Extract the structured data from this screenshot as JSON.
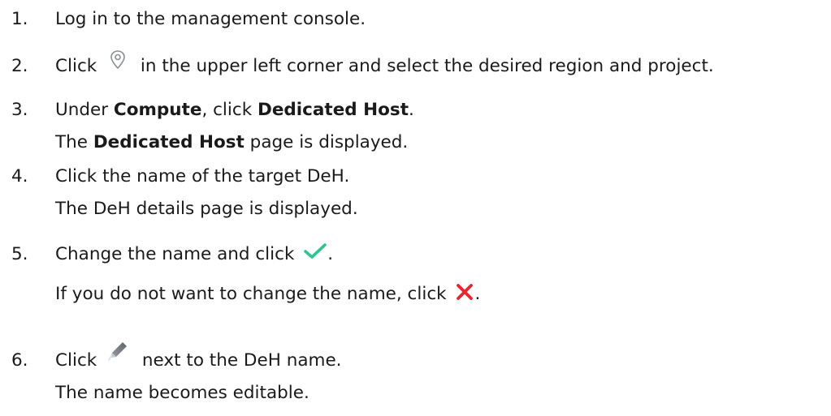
{
  "steps": [
    {
      "number": "1.",
      "text": "Log in to the management console."
    },
    {
      "number": "2.",
      "before": "Click",
      "icon": "location-pin-icon",
      "after": "in the upper left corner and select the desired region and project."
    },
    {
      "number": "3.",
      "t1": "Under ",
      "b1": "Compute",
      "t2": ", click ",
      "b2": "Dedicated Host",
      "t3": ".",
      "sub_t1": "The ",
      "sub_b1": "Dedicated Host",
      "sub_t2": " page is displayed."
    },
    {
      "number": "4.",
      "text": "Click the name of the target DeH.",
      "sub": "The DeH details page is displayed."
    },
    {
      "number": "5.",
      "before": "Change the name and click",
      "icon": "checkmark-icon",
      "after": ".",
      "sub_before": "If you do not want to change the name, click",
      "sub_icon": "cross-icon",
      "sub_after": "."
    },
    {
      "number": "6.",
      "before": "Click",
      "icon": "pencil-icon",
      "after": "next to the DeH name.",
      "sub": "The name becomes editable."
    }
  ],
  "colors": {
    "text": "#1a1a1a",
    "check": "#2fc48d",
    "cross": "#e8262f",
    "pin": "#8a8f96"
  }
}
